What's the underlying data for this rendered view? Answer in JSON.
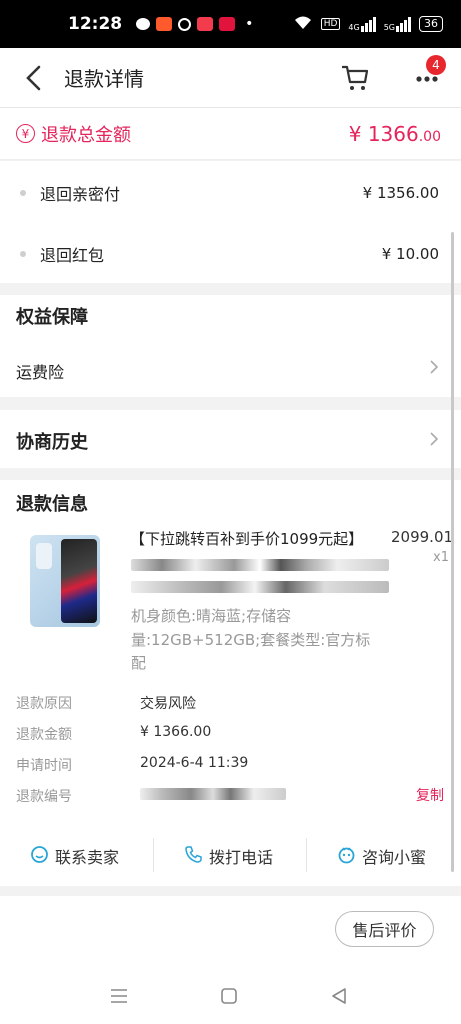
{
  "status_bar": {
    "time": "12:28",
    "network": "4G",
    "network2": "5G",
    "battery": "36",
    "hd": "HD"
  },
  "header": {
    "title": "退款详情",
    "badge_count": "4"
  },
  "refund_total": {
    "currency_icon": "¥",
    "label": "退款总金额",
    "amount_main": "¥ 1366",
    "amount_decimal": ".00"
  },
  "refund_breakdown": [
    {
      "label": "退回亲密付",
      "amount": "¥ 1356.00"
    },
    {
      "label": "退回红包",
      "amount": "¥ 10.00"
    }
  ],
  "rights": {
    "title": "权益保障",
    "item": "运费险"
  },
  "negotiation": {
    "title": "协商历史"
  },
  "refund_info": {
    "title": "退款信息",
    "product_title": "【下拉跳转百补到手价1099元起】",
    "price": "2099.01",
    "quantity": "x1",
    "spec_line1": "机身颜色:晴海蓝;存储容",
    "spec_line2": "量:12GB+512GB;套餐类型:官方标",
    "spec_line3": "配",
    "fields": [
      {
        "label": "退款原因",
        "value": "交易风险"
      },
      {
        "label": "退款金额",
        "value": "¥ 1366.00"
      },
      {
        "label": "申请时间",
        "value": "2024-6-4 11:39"
      },
      {
        "label": "退款编号",
        "value": ""
      }
    ],
    "copy_label": "复制"
  },
  "actions": {
    "contact_seller": "联系卖家",
    "call": "拨打电话",
    "ask_assistant": "咨询小蜜"
  },
  "footer": {
    "review_button": "售后评价"
  },
  "colors": {
    "accent": "#e5245b",
    "badge": "#e8262d",
    "icon_blue": "#2aa6d6"
  }
}
